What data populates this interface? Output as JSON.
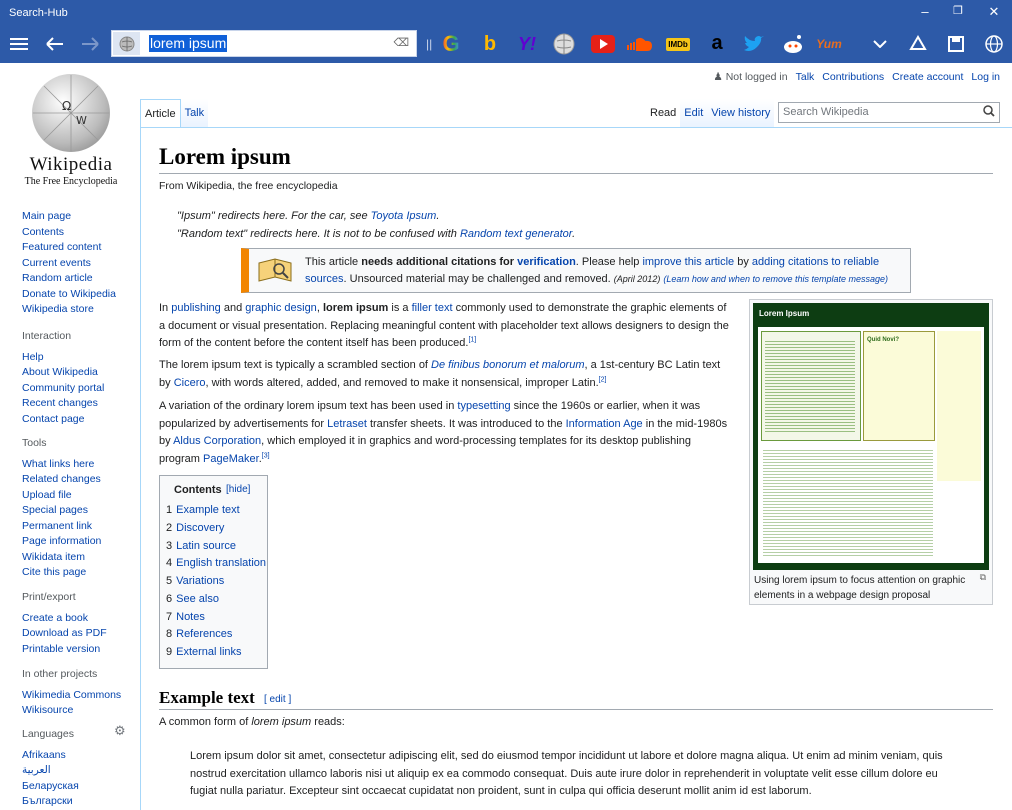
{
  "window": {
    "title": "Search-Hub"
  },
  "toolbar": {
    "query": "lorem ipsum",
    "engines": [
      "google",
      "bing",
      "yahoo",
      "wikipedia",
      "youtube",
      "soundcloud",
      "imdb",
      "amazon",
      "twitter",
      "reddit",
      "yummly"
    ]
  },
  "personal": {
    "not_logged_in": "Not logged in",
    "talk": "Talk",
    "contributions": "Contributions",
    "create_account": "Create account",
    "login": "Log in"
  },
  "logo": {
    "wordmark": "Wikipedia",
    "tagline": "The Free Encyclopedia"
  },
  "sidebar": {
    "nav": [
      "Main page",
      "Contents",
      "Featured content",
      "Current events",
      "Random article",
      "Donate to Wikipedia",
      "Wikipedia store"
    ],
    "interaction": {
      "heading": "Interaction",
      "items": [
        "Help",
        "About Wikipedia",
        "Community portal",
        "Recent changes",
        "Contact page"
      ]
    },
    "tools": {
      "heading": "Tools",
      "items": [
        "What links here",
        "Related changes",
        "Upload file",
        "Special pages",
        "Permanent link",
        "Page information",
        "Wikidata item",
        "Cite this page"
      ]
    },
    "print": {
      "heading": "Print/export",
      "items": [
        "Create a book",
        "Download as PDF",
        "Printable version"
      ]
    },
    "projects": {
      "heading": "In other projects",
      "items": [
        "Wikimedia Commons",
        "Wikisource"
      ]
    },
    "languages": {
      "heading": "Languages",
      "items": [
        "Afrikaans",
        "العربية",
        "Беларуская",
        "Български"
      ]
    }
  },
  "tabs": {
    "article": "Article",
    "talk": "Talk",
    "read": "Read",
    "edit": "Edit",
    "history": "View history",
    "search_placeholder": "Search Wikipedia"
  },
  "article": {
    "title": "Lorem ipsum",
    "from": "From Wikipedia, the free encyclopedia",
    "hatnote1": {
      "a": "\"Ipsum\" redirects here. For the car, see ",
      "link": "Toyota Ipsum",
      "b": "."
    },
    "hatnote2": {
      "a": "\"Random text\" redirects here. It is not to be confused with ",
      "link": "Random text generator",
      "b": "."
    },
    "ambox": {
      "t1": "This article ",
      "bold": "needs additional citations for ",
      "verif": "verification",
      "t2": ". Please help ",
      "improve": "improve this article",
      "t3": " by ",
      "adding": "adding citations to reliable sources",
      "t4": ". Unsourced material may be challenged and removed. ",
      "date": "(April 2012)",
      "learn": "(Learn how and when to remove this template message)"
    },
    "p1": {
      "a": "In ",
      "l1": "publishing",
      "b": " and ",
      "l2": "graphic design",
      "c": ", ",
      "bold": "lorem ipsum",
      "d": " is a ",
      "l3": "filler text",
      "e": " commonly used to demonstrate the graphic elements of a document or visual presentation. Replacing meaningful content with placeholder text allows designers to design the form of the content before the content itself has been produced.",
      "ref": "[1]"
    },
    "p2": {
      "a": "The lorem ipsum text is typically a scrambled section of ",
      "l1": "De finibus bonorum et malorum",
      "b": ", a 1st-century BC Latin text by ",
      "l2": "Cicero",
      "c": ", with words altered, added, and removed to make it nonsensical, improper Latin.",
      "ref": "[2]"
    },
    "p3": {
      "a": "A variation of the ordinary lorem ipsum text has been used in ",
      "l1": "typesetting",
      "b": " since the 1960s or earlier, when it was popularized by advertisements for ",
      "l2": "Letraset",
      "c": " transfer sheets. It was introduced to the ",
      "l3": "Information Age",
      "d": " in the mid-1980s by ",
      "l4": "Aldus Corporation",
      "e": ", which employed it in graphics and word-processing templates for its desktop publishing program ",
      "l5": "PageMaker",
      "f": ".",
      "ref": "[3]"
    },
    "caption": "Using lorem ipsum to focus attention on graphic elements in a webpage design proposal",
    "infobox_image": {
      "heading": "Lorem Ipsum",
      "sub": "Quid Novi?"
    },
    "toc": {
      "title": "Contents",
      "hide": "[hide]",
      "items": [
        {
          "n": "1",
          "t": "Example text"
        },
        {
          "n": "2",
          "t": "Discovery"
        },
        {
          "n": "3",
          "t": "Latin source"
        },
        {
          "n": "4",
          "t": "English translation"
        },
        {
          "n": "5",
          "t": "Variations"
        },
        {
          "n": "6",
          "t": "See also"
        },
        {
          "n": "7",
          "t": "Notes"
        },
        {
          "n": "8",
          "t": "References"
        },
        {
          "n": "9",
          "t": "External links"
        }
      ]
    },
    "section": {
      "title": "Example text",
      "edit": "[ edit ]",
      "intro_a": "A common form of ",
      "intro_i": "lorem ipsum",
      "intro_b": " reads:"
    },
    "quote": "Lorem ipsum dolor sit amet, consectetur adipiscing elit, sed do eiusmod tempor incididunt ut labore et dolore magna aliqua. Ut enim ad minim veniam, quis nostrud exercitation ullamco laboris nisi ut aliquip ex ea commodo consequat. Duis aute irure dolor in reprehenderit in voluptate velit esse cillum dolore eu fugiat nulla pariatur. Excepteur sint occaecat cupidatat non proident, sunt in culpa qui officia deserunt mollit anim id est laborum."
  }
}
